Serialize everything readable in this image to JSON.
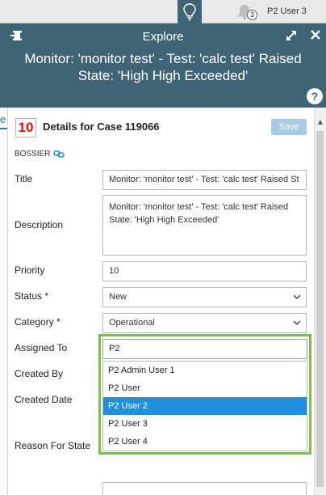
{
  "topbar": {
    "notification_count": "3",
    "user_name": "P2 User 3",
    "icons": {
      "bulb": "lightbulb-icon",
      "bell": "bell-icon"
    }
  },
  "explore": {
    "title": "Explore",
    "subtitle": "Monitor: 'monitor test' - Test: 'calc test' Raised State: 'High High Exceeded'",
    "icons": {
      "pin": "pin-icon",
      "expand": "expand-icon",
      "close": "close-icon",
      "help": "help-icon"
    },
    "help_glyph": "?"
  },
  "left_tab": {
    "label": "e"
  },
  "case": {
    "number": "10",
    "title": "Details for Case 119066",
    "save_label": "Save",
    "org": "BOSSIER"
  },
  "fields": {
    "title_label": "Title",
    "title_value": "Monitor: 'monitor test' - Test: 'calc test' Raised St",
    "description_label": "Description",
    "description_value": "Monitor: 'monitor test' - Test: 'calc test' Raised State: 'High High Exceeded'",
    "priority_label": "Priority",
    "priority_value": "10",
    "status_label": "Status *",
    "status_value": "New",
    "category_label": "Category *",
    "category_value": "Operational",
    "assigned_label": "Assigned To",
    "assigned_value": "P2",
    "created_by_label": "Created By",
    "created_date_label": "Created Date",
    "reason_label": "Reason For State"
  },
  "dropdown": {
    "items": [
      "P2 Admin User 1",
      "P2 User",
      "P2 User 2",
      "P2 User 3",
      "P2 User 4"
    ],
    "selected": "P2 User 2"
  },
  "colors": {
    "header_bg": "#3f6475",
    "accent_green": "#7ac143",
    "selected_blue": "#1e90e0",
    "case_number_red": "#e01010",
    "save_button": "#a9c9e4"
  }
}
